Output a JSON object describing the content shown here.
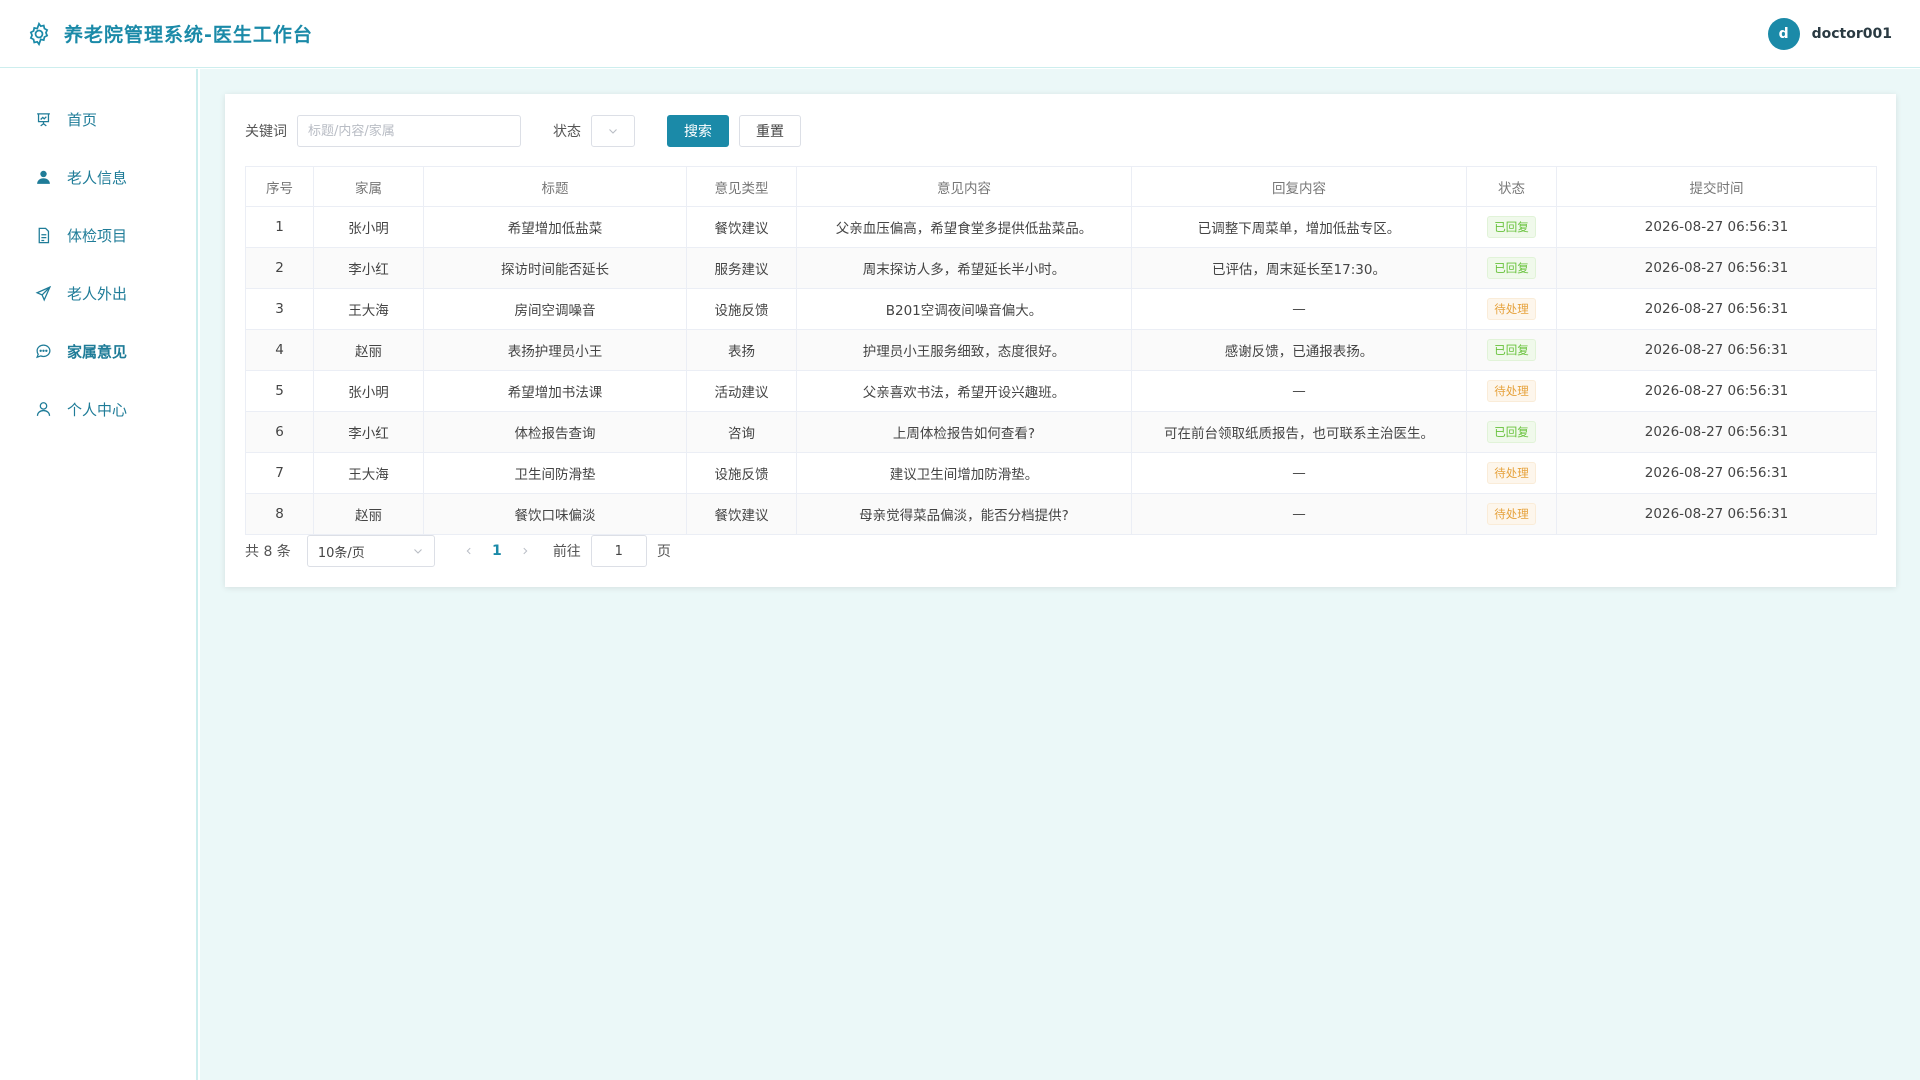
{
  "header": {
    "title": "养老院管理系统-医生工作台",
    "avatar_letter": "d",
    "username": "doctor001"
  },
  "sidebar": {
    "items": [
      {
        "label": "首页",
        "icon": "presentation-chart-icon"
      },
      {
        "label": "老人信息",
        "icon": "user-filled-icon"
      },
      {
        "label": "体检项目",
        "icon": "document-icon"
      },
      {
        "label": "老人外出",
        "icon": "navigation-arrow-icon"
      },
      {
        "label": "家属意见",
        "icon": "chat-dots-icon",
        "active": true
      },
      {
        "label": "个人中心",
        "icon": "user-outline-icon"
      }
    ]
  },
  "filters": {
    "keyword_label": "关键词",
    "keyword_placeholder": "标题/内容/家属",
    "keyword_value": "",
    "status_label": "状态",
    "status_value": "",
    "search_label": "搜索",
    "reset_label": "重置"
  },
  "table": {
    "columns": [
      "序号",
      "家属",
      "标题",
      "意见类型",
      "意见内容",
      "回复内容",
      "状态",
      "提交时间"
    ],
    "rows": [
      {
        "no": "1",
        "family": "张小明",
        "title": "希望增加低盐菜",
        "type": "餐饮建议",
        "content": "父亲血压偏高，希望食堂多提供低盐菜品。",
        "reply": "已调整下周菜单，增加低盐专区。",
        "status": "已回复",
        "status_kind": "ok",
        "time": "2026-08-27 06:56:31"
      },
      {
        "no": "2",
        "family": "李小红",
        "title": "探访时间能否延长",
        "type": "服务建议",
        "content": "周末探访人多，希望延长半小时。",
        "reply": "已评估，周末延长至17:30。",
        "status": "已回复",
        "status_kind": "ok",
        "time": "2026-08-27 06:56:31"
      },
      {
        "no": "3",
        "family": "王大海",
        "title": "房间空调噪音",
        "type": "设施反馈",
        "content": "B201空调夜间噪音偏大。",
        "reply": "—",
        "status": "待处理",
        "status_kind": "pending",
        "time": "2026-08-27 06:56:31"
      },
      {
        "no": "4",
        "family": "赵丽",
        "title": "表扬护理员小王",
        "type": "表扬",
        "content": "护理员小王服务细致，态度很好。",
        "reply": "感谢反馈，已通报表扬。",
        "status": "已回复",
        "status_kind": "ok",
        "time": "2026-08-27 06:56:31"
      },
      {
        "no": "5",
        "family": "张小明",
        "title": "希望增加书法课",
        "type": "活动建议",
        "content": "父亲喜欢书法，希望开设兴趣班。",
        "reply": "—",
        "status": "待处理",
        "status_kind": "pending",
        "time": "2026-08-27 06:56:31"
      },
      {
        "no": "6",
        "family": "李小红",
        "title": "体检报告查询",
        "type": "咨询",
        "content": "上周体检报告如何查看?",
        "reply": "可在前台领取纸质报告，也可联系主治医生。",
        "status": "已回复",
        "status_kind": "ok",
        "time": "2026-08-27 06:56:31"
      },
      {
        "no": "7",
        "family": "王大海",
        "title": "卫生间防滑垫",
        "type": "设施反馈",
        "content": "建议卫生间增加防滑垫。",
        "reply": "—",
        "status": "待处理",
        "status_kind": "pending",
        "time": "2026-08-27 06:56:31"
      },
      {
        "no": "8",
        "family": "赵丽",
        "title": "餐饮口味偏淡",
        "type": "餐饮建议",
        "content": "母亲觉得菜品偏淡，能否分档提供?",
        "reply": "—",
        "status": "待处理",
        "status_kind": "pending",
        "time": "2026-08-27 06:56:31"
      }
    ]
  },
  "pagination": {
    "total_text": "共 8 条",
    "page_size": "10条/页",
    "current_page": "1",
    "goto_label": "前往",
    "goto_value": "1",
    "page_suffix": "页"
  },
  "colors": {
    "accent": "#1b8aa8",
    "background": "#ebf8f8",
    "tag_ok": "#67c23a",
    "tag_pending": "#e6a23c"
  }
}
